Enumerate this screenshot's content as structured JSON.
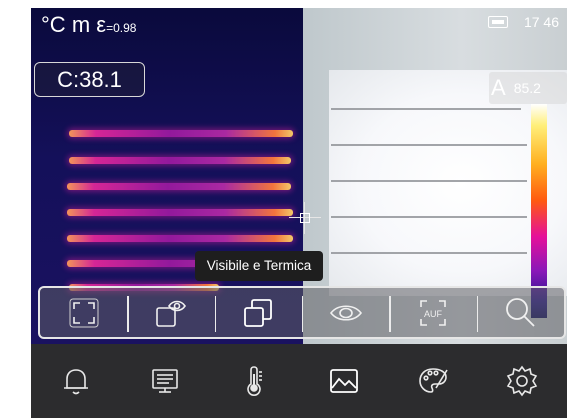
{
  "status_bar": {
    "temp_unit": "°C",
    "distance_unit": "m",
    "emissivity_symbol": "ε",
    "emissivity_value": "=0.98",
    "time": "17 46"
  },
  "measurement": {
    "center_label": "C:38.1"
  },
  "scale": {
    "mode": "A",
    "max_value": "85.2"
  },
  "tooltip": {
    "text": "Visibile e Termica"
  },
  "toolbar": {
    "tools": [
      {
        "name": "full-frame",
        "icon": "frame-corners-icon"
      },
      {
        "name": "picture-in-picture",
        "icon": "pip-eye-icon"
      },
      {
        "name": "visible-and-thermal",
        "icon": "overlap-squares-icon"
      },
      {
        "name": "visible-only",
        "icon": "eye-icon"
      },
      {
        "name": "auto-focus",
        "icon": "auf-icon",
        "label": "AUF"
      },
      {
        "name": "zoom",
        "icon": "magnifier-icon"
      }
    ]
  },
  "navbar": {
    "items": [
      {
        "name": "alarm",
        "icon": "bell-icon"
      },
      {
        "name": "display",
        "icon": "monitor-icon"
      },
      {
        "name": "temperature",
        "icon": "thermometer-icon"
      },
      {
        "name": "image",
        "icon": "image-icon"
      },
      {
        "name": "palette",
        "icon": "palette-icon"
      },
      {
        "name": "settings",
        "icon": "gear-icon"
      }
    ]
  },
  "colors": {
    "toolbar_border": "#e6e6e6",
    "nav_bg": "#2c2c2e",
    "thermal_bg": "#14105a"
  }
}
